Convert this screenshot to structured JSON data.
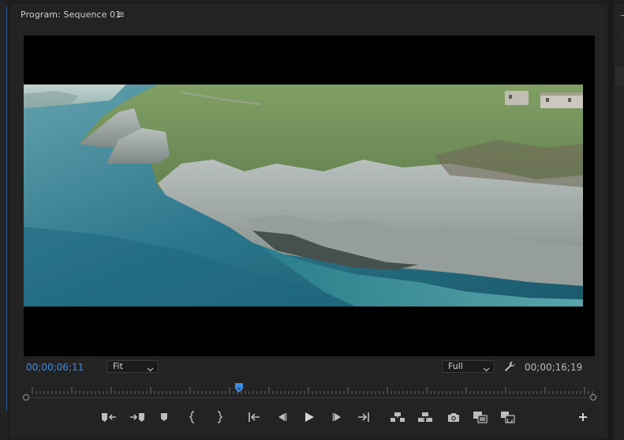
{
  "panel": {
    "title": "Program: Sequence 01",
    "menu_glyph": "≡"
  },
  "transport": {
    "current_timecode": "00;00;06;11",
    "duration_timecode": "00;00;16;19",
    "zoom_select": "Fit",
    "resolution_select": "Full",
    "playhead_fraction": 0.38
  },
  "controls": [
    {
      "name": "mark-in-icon"
    },
    {
      "name": "mark-out-icon"
    },
    {
      "name": "add-marker-icon"
    },
    {
      "name": "go-to-in-icon"
    },
    {
      "name": "go-to-out-icon"
    },
    {
      "name": "go-to-in-point-icon"
    },
    {
      "name": "step-back-icon"
    },
    {
      "name": "play-icon"
    },
    {
      "name": "step-forward-icon"
    },
    {
      "name": "go-to-out-point-icon"
    },
    {
      "name": "lift-icon"
    },
    {
      "name": "extract-icon"
    },
    {
      "name": "export-frame-icon"
    },
    {
      "name": "comparison-view-icon"
    },
    {
      "name": "vr-video-icon"
    },
    {
      "name": "button-editor-icon"
    }
  ],
  "colors": {
    "accent": "#3f8ce0",
    "panel_bg": "#232323",
    "video_bg": "#000000"
  }
}
